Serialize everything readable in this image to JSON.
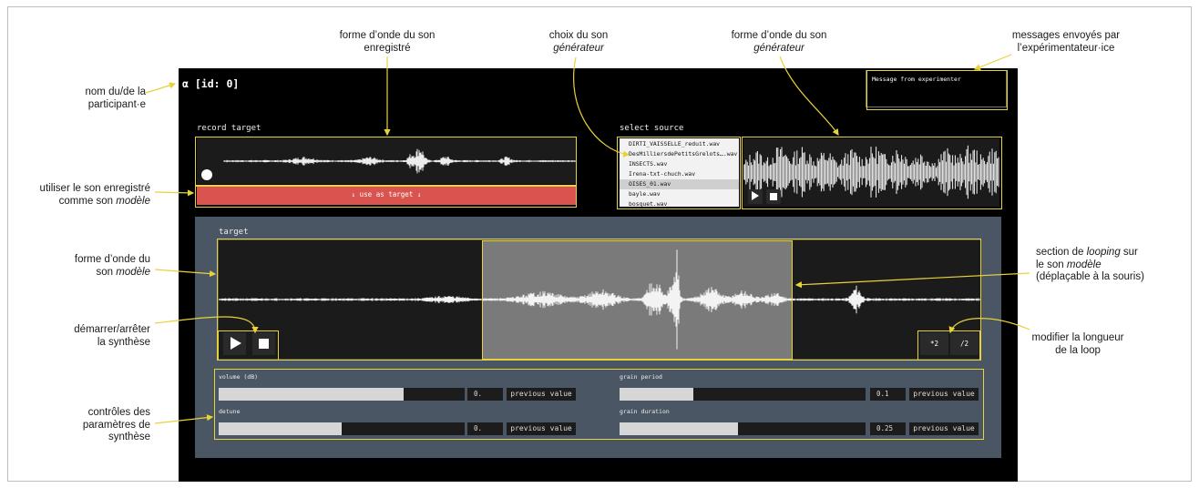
{
  "app": {
    "participant_name": "α [id: 0]",
    "message_box": "Message from experimenter",
    "record": {
      "label": "record target",
      "use_as_target": "↓ use as target ↓"
    },
    "source": {
      "label": "select source",
      "items": [
        "DIRTI_VAISSELLE_reduit.wav",
        "DesMilliersdePetitsGrelots….wav",
        "INSECTS.wav",
        "Irena-txt-chuch.wav",
        "OISES_01.wav",
        "bayle.wav",
        "bosquet.wav"
      ],
      "selected_index": 4
    },
    "target": {
      "label": "target",
      "loop_double": "*2",
      "loop_half": "/2"
    },
    "params": [
      {
        "label": "volume (dB)",
        "value": "0.",
        "fill": 0.75,
        "button": "previous value"
      },
      {
        "label": "detune",
        "value": "0.",
        "fill": 0.5,
        "button": "previous value"
      },
      {
        "label": "grain period",
        "value": "0.1",
        "fill": 0.3,
        "button": "previous value"
      },
      {
        "label": "grain duration",
        "value": "0.25",
        "fill": 0.48,
        "button": "previous value"
      }
    ]
  },
  "annotations": {
    "participant_line1": "nom du/de la",
    "participant_line2": "participant·e",
    "recorded_wave_line1": "forme d’onde du son",
    "recorded_wave_line2": "enregistré",
    "choice_line1": "choix du son",
    "choice_line2": "générateur",
    "gen_wave_line1": "forme d’onde du son",
    "gen_wave_line2": "générateur",
    "messages_line1": "messages envoyés par",
    "messages_line2": "l’expérimentateur·ice",
    "use_recorded_line1": "utiliser le son enregistré",
    "use_recorded_line2a": "comme son ",
    "use_recorded_line2b": "modèle",
    "model_wave_line1": "forme d’onde du",
    "model_wave_line2a": "son ",
    "model_wave_line2b": "modèle",
    "looping_line1a": "section de ",
    "looping_line1b": "looping",
    "looping_line1c": " sur",
    "looping_line2a": "le son ",
    "looping_line2b": "modèle",
    "looping_line3": "(déplaçable à la souris)",
    "startstop_line1": "démarrer/arrêter",
    "startstop_line2": "la synthèse",
    "looplength_line1": "modifier la longueur",
    "looplength_line2": "de la loop",
    "controls_line1": "contrôles des",
    "controls_line2": "paramètres de",
    "controls_line3": "synthèse"
  },
  "colors": {
    "annotation_yellow": "#e8d23a",
    "use_target_red": "#d9534f",
    "target_panel": "#4a5663",
    "loop_section": "#7a7a7a"
  }
}
